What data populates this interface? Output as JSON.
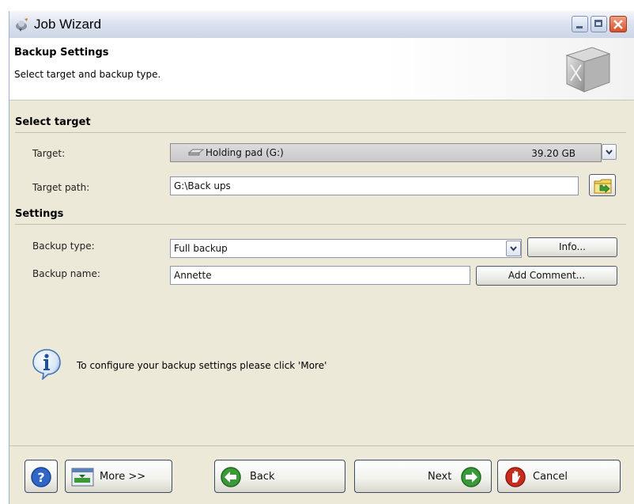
{
  "window": {
    "title": "Job Wizard"
  },
  "header": {
    "title": "Backup Settings",
    "subtitle": "Select target and backup type."
  },
  "select_target": {
    "section_title": "Select target",
    "target_label": "Target:",
    "target_value": "Holding pad (G:)",
    "target_size": "39.20 GB",
    "target_path_label": "Target path:",
    "target_path_value": "G:\\Back ups"
  },
  "settings": {
    "section_title": "Settings",
    "backup_type_label": "Backup type:",
    "backup_type_value": "Full backup",
    "info_button": "Info...",
    "backup_name_label": "Backup name:",
    "backup_name_value": "Annette",
    "add_comment_button": "Add Comment..."
  },
  "info_message": "To configure your backup settings please click 'More'",
  "footer": {
    "more_button": "More >>",
    "back_button": "Back",
    "next_button": "Next",
    "cancel_button": "Cancel"
  },
  "colors": {
    "window_bg": "#ece9d8",
    "help_blue": "#2e67c8",
    "nav_green": "#3a9a3a",
    "cancel_red": "#c62d1f"
  }
}
